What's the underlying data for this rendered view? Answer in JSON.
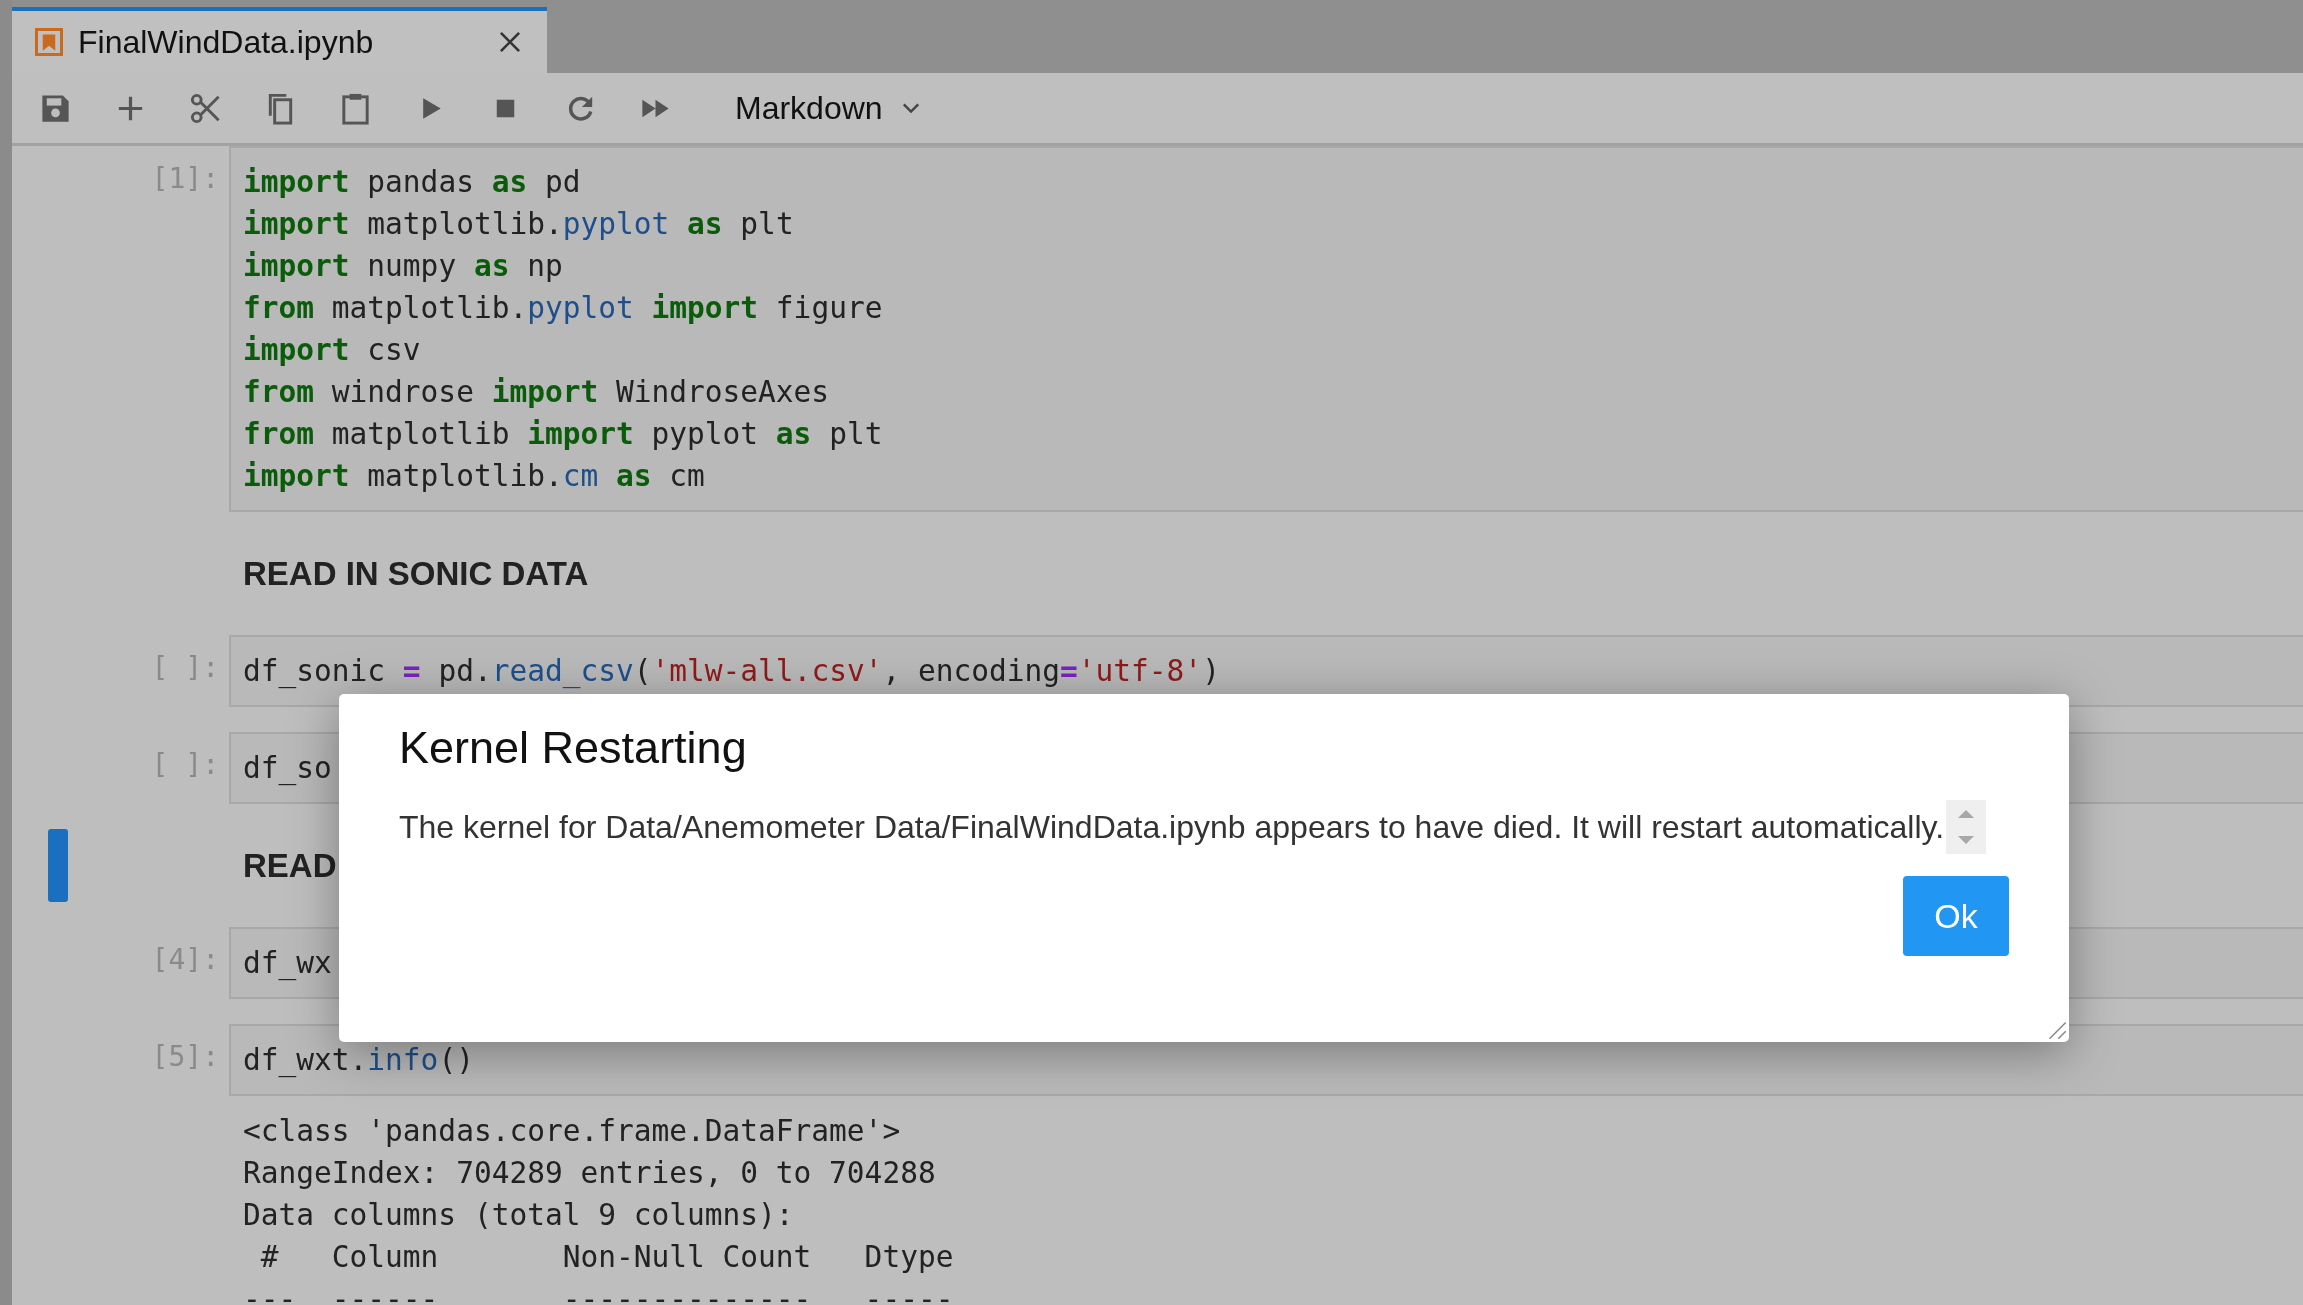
{
  "tab": {
    "title": "FinalWindData.ipynb",
    "selected": true
  },
  "toolbar": {
    "cell_type": "Markdown"
  },
  "cells": [
    {
      "kind": "code",
      "prompt": "[1]:",
      "selected": false,
      "lines": [
        [
          {
            "kind": "keyword",
            "text": "import"
          },
          {
            "kind": "plain",
            "text": " pandas "
          },
          {
            "kind": "keyword",
            "text": "as"
          },
          {
            "kind": "plain",
            "text": " pd"
          }
        ],
        [
          {
            "kind": "keyword",
            "text": "import"
          },
          {
            "kind": "plain",
            "text": " matplotlib."
          },
          {
            "kind": "attr",
            "text": "pyplot"
          },
          {
            "kind": "keyword",
            "text": " as"
          },
          {
            "kind": "plain",
            "text": " plt"
          }
        ],
        [
          {
            "kind": "keyword",
            "text": "import"
          },
          {
            "kind": "plain",
            "text": " numpy "
          },
          {
            "kind": "keyword",
            "text": "as"
          },
          {
            "kind": "plain",
            "text": " np"
          }
        ],
        [
          {
            "kind": "keyword",
            "text": "from"
          },
          {
            "kind": "plain",
            "text": " matplotlib."
          },
          {
            "kind": "attr",
            "text": "pyplot"
          },
          {
            "kind": "keyword",
            "text": " import"
          },
          {
            "kind": "plain",
            "text": " figure"
          }
        ],
        [
          {
            "kind": "keyword",
            "text": "import"
          },
          {
            "kind": "plain",
            "text": " csv"
          }
        ],
        [
          {
            "kind": "keyword",
            "text": "from"
          },
          {
            "kind": "plain",
            "text": " windrose "
          },
          {
            "kind": "keyword",
            "text": "import"
          },
          {
            "kind": "plain",
            "text": " WindroseAxes"
          }
        ],
        [
          {
            "kind": "keyword",
            "text": "from"
          },
          {
            "kind": "plain",
            "text": " matplotlib "
          },
          {
            "kind": "keyword",
            "text": "import"
          },
          {
            "kind": "plain",
            "text": " pyplot "
          },
          {
            "kind": "keyword",
            "text": "as"
          },
          {
            "kind": "plain",
            "text": " plt"
          }
        ],
        [
          {
            "kind": "keyword",
            "text": "import"
          },
          {
            "kind": "plain",
            "text": " matplotlib."
          },
          {
            "kind": "attr",
            "text": "cm"
          },
          {
            "kind": "keyword",
            "text": " as"
          },
          {
            "kind": "plain",
            "text": " cm"
          }
        ]
      ]
    },
    {
      "kind": "markdown",
      "selected": false,
      "text": "READ IN SONIC DATA"
    },
    {
      "kind": "code",
      "prompt": "[ ]:",
      "selected": false,
      "lines": [
        [
          {
            "kind": "plain",
            "text": "df_sonic "
          },
          {
            "kind": "operator",
            "text": "="
          },
          {
            "kind": "plain",
            "text": " pd."
          },
          {
            "kind": "attr",
            "text": "read_csv"
          },
          {
            "kind": "plain",
            "text": "("
          },
          {
            "kind": "string",
            "text": "'mlw-all.csv'"
          },
          {
            "kind": "plain",
            "text": ", encoding"
          },
          {
            "kind": "operator",
            "text": "="
          },
          {
            "kind": "string",
            "text": "'utf-8'"
          },
          {
            "kind": "plain",
            "text": ")"
          }
        ]
      ]
    },
    {
      "kind": "code",
      "prompt": "[ ]:",
      "selected": false,
      "lines": [
        [
          {
            "kind": "plain",
            "text": "df_so"
          }
        ]
      ]
    },
    {
      "kind": "markdown",
      "selected": true,
      "text": "READ"
    },
    {
      "kind": "code",
      "prompt": "[4]:",
      "selected": false,
      "lines": [
        [
          {
            "kind": "plain",
            "text": "df_wx"
          }
        ]
      ]
    },
    {
      "kind": "code",
      "prompt": "[5]:",
      "selected": false,
      "lines": [
        [
          {
            "kind": "plain",
            "text": "df_wxt."
          },
          {
            "kind": "attr",
            "text": "info"
          },
          {
            "kind": "plain",
            "text": "()"
          }
        ]
      ],
      "output": [
        "<class 'pandas.core.frame.DataFrame'>",
        "RangeIndex: 704289 entries, 0 to 704288",
        "Data columns (total 9 columns):",
        " #   Column       Non-Null Count   Dtype",
        "---  ------       --------------   -----"
      ]
    }
  ],
  "dialog": {
    "title": "Kernel Restarting",
    "message": "The kernel for Data/Anemometer Data/FinalWindData.ipynb appears to have died. It will restart automatically.",
    "button": "Ok"
  }
}
